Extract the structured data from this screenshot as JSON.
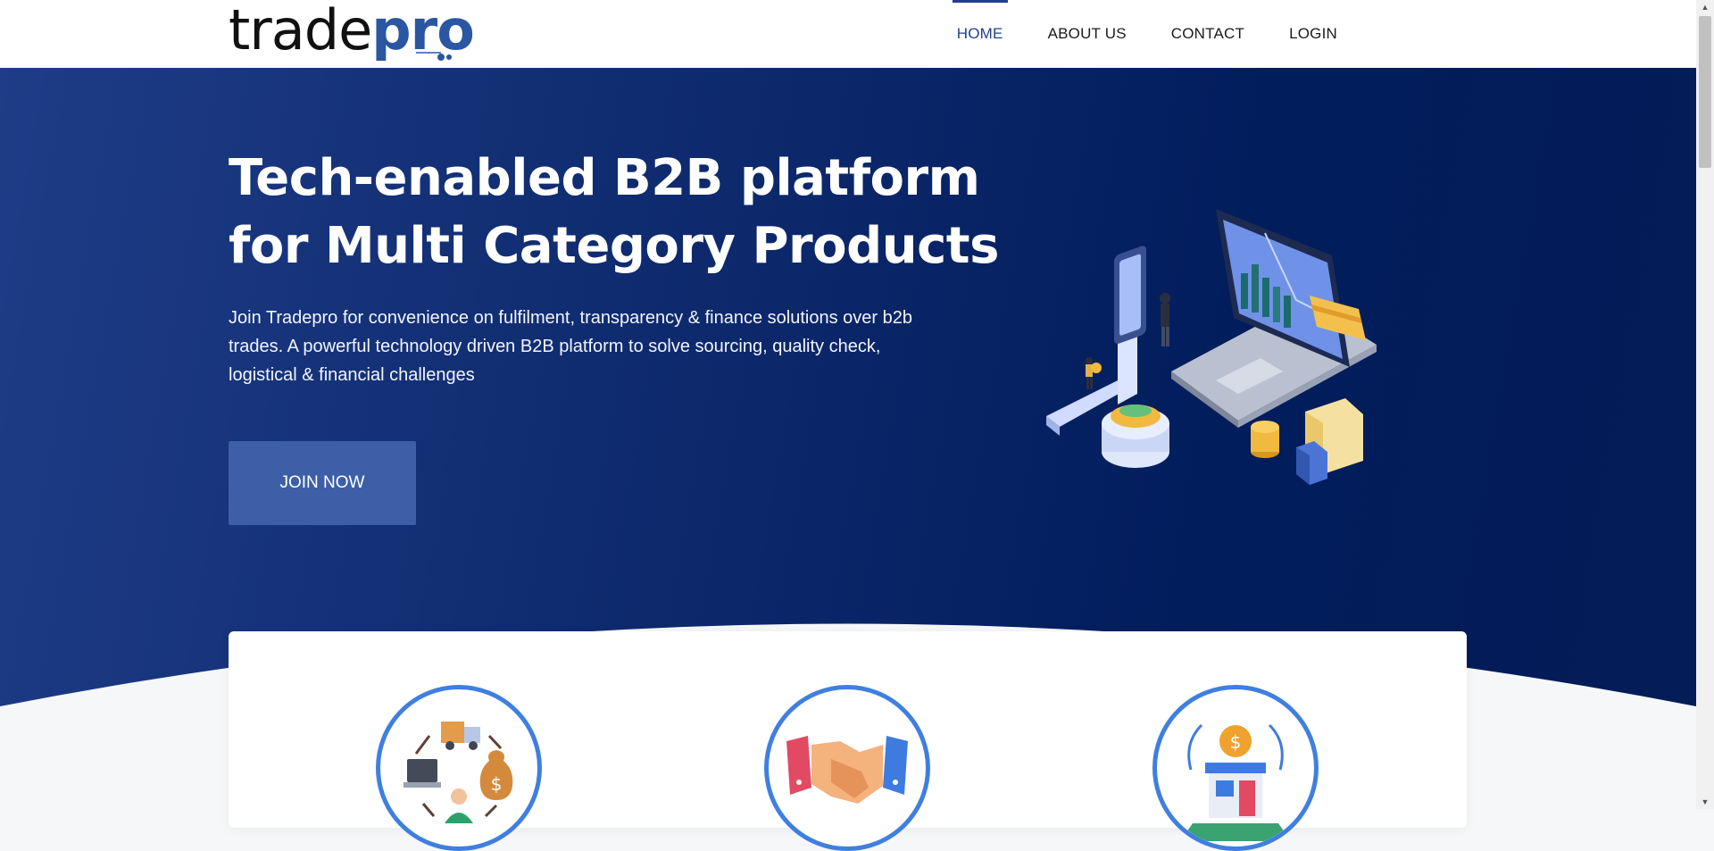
{
  "brand": {
    "name_part1": "trade",
    "name_part2": "pro",
    "primary_color": "#213f8c",
    "accent_color": "#2a56a3"
  },
  "nav": {
    "items": [
      {
        "label": "HOME",
        "active": true
      },
      {
        "label": "ABOUT US",
        "active": false
      },
      {
        "label": "CONTACT",
        "active": false
      },
      {
        "label": "LOGIN",
        "active": false
      }
    ]
  },
  "hero": {
    "title_line1": "Tech-enabled B2B platform",
    "title_line2": "for Multi Category Products",
    "description": "Join Tradepro for convenience on fulfilment, transparency & finance solutions over b2b trades. A powerful technology driven B2B platform to solve sourcing, quality check, logistical & financial challenges",
    "cta_label": "JOIN NOW",
    "illustration_icon": "laptop-analytics-illustration"
  },
  "features": {
    "icons": [
      "logistics-cycle-icon",
      "handshake-icon",
      "storefront-money-icon"
    ],
    "icon_ring_color": "#3f7fe0"
  }
}
